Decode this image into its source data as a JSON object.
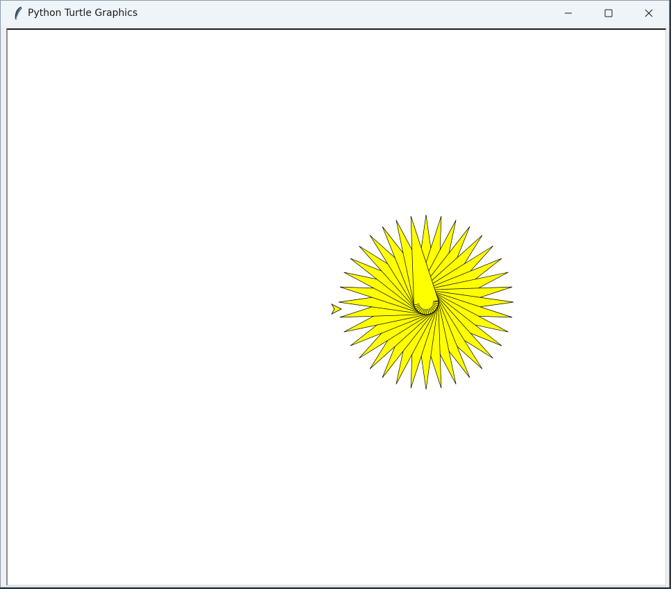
{
  "window": {
    "title": "Python Turtle Graphics",
    "app_icon": "feather-icon"
  },
  "caption_buttons": {
    "minimize_icon": "minimize-icon",
    "maximize_icon": "maximize-icon",
    "close_icon": "close-icon"
  },
  "canvas": {
    "background_color": "#ffffff",
    "drawing": {
      "shape": "star-burst",
      "fill_color": "#ffff00",
      "stroke_color": "#000000",
      "point_count": 36,
      "center_dot_color": "#ffff00",
      "turtle_cursor": "arrow-turtle-icon",
      "turtle_color": "#ffff00"
    }
  }
}
